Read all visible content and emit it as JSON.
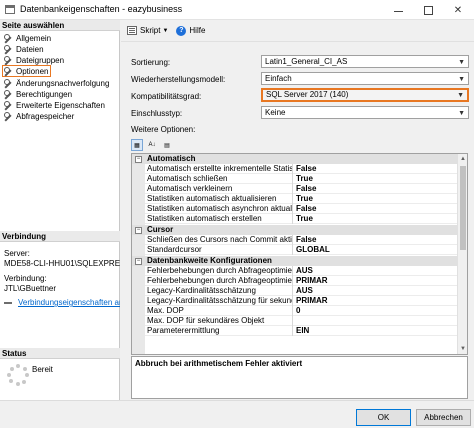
{
  "window": {
    "title": "Datenbankeigenschaften - eazybusiness",
    "close_glyph": "✕"
  },
  "left": {
    "page_select_header": "Seite auswählen",
    "pages": [
      "Allgemein",
      "Dateien",
      "Dateigruppen",
      "Optionen",
      "Änderungsnachverfolgung",
      "Berechtigungen",
      "Erweiterte Eigenschaften",
      "Abfragespeicher"
    ],
    "active_page": "Optionen",
    "connection_header": "Verbindung",
    "server_label": "Server:",
    "server_value": "MDE58-CLI-HHU01\\SQLEXPRESS",
    "connection_label": "Verbindung:",
    "connection_value": "JTL\\GBuettner",
    "connection_props_link": "Verbindungseigenschaften anzeigen",
    "status_header": "Status",
    "status_value": "Bereit"
  },
  "toolbar": {
    "script_label": "Skript",
    "help_label": "Hilfe"
  },
  "form": {
    "sort_label": "Sortierung:",
    "sort_value": "Latin1_General_CI_AS",
    "recovery_label": "Wiederherstellungsmodell:",
    "recovery_value": "Einfach",
    "compat_label": "Kompatibilitätsgrad:",
    "compat_value": "SQL Server 2017 (140)",
    "containment_label": "Einschlusstyp:",
    "containment_value": "Keine",
    "more_options_label": "Weitere Optionen:"
  },
  "property_grid": {
    "categories": [
      {
        "name": "Automatisch",
        "rows": [
          {
            "name": "Automatisch erstellte inkrementelle Statistiken",
            "value": "False"
          },
          {
            "name": "Automatisch schließen",
            "value": "True"
          },
          {
            "name": "Automatisch verkleinern",
            "value": "False"
          },
          {
            "name": "Statistiken automatisch aktualisieren",
            "value": "True"
          },
          {
            "name": "Statistiken automatisch asynchron aktualisieren",
            "value": "False"
          },
          {
            "name": "Statistiken automatisch erstellen",
            "value": "True"
          }
        ]
      },
      {
        "name": "Cursor",
        "rows": [
          {
            "name": "Schließen des Cursors nach Commit aktiviert",
            "value": "False"
          },
          {
            "name": "Standardcursor",
            "value": "GLOBAL"
          }
        ]
      },
      {
        "name": "Datenbankweite Konfigurationen",
        "rows": [
          {
            "name": "Fehlerbehebungen durch Abfrageoptimierer",
            "value": "AUS"
          },
          {
            "name": "Fehlerbehebungen durch Abfrageoptimierer",
            "value": "PRIMAR"
          },
          {
            "name": "Legacy-Kardinalitätsschätzung",
            "value": "AUS"
          },
          {
            "name": "Legacy-Kardinalitätsschätzung für sekundäre",
            "value": "PRIMAR"
          },
          {
            "name": "Max. DOP",
            "value": "0"
          },
          {
            "name": "Max. DOP für sekundäres Objekt",
            "value": ""
          },
          {
            "name": "Parameterermittlung",
            "value": "EIN"
          }
        ]
      }
    ],
    "description": "Abbruch bei arithmetischem Fehler aktiviert"
  },
  "buttons": {
    "ok": "OK",
    "cancel": "Abbrechen"
  },
  "colors": {
    "highlight": "#e87722",
    "link": "#0066cc"
  }
}
